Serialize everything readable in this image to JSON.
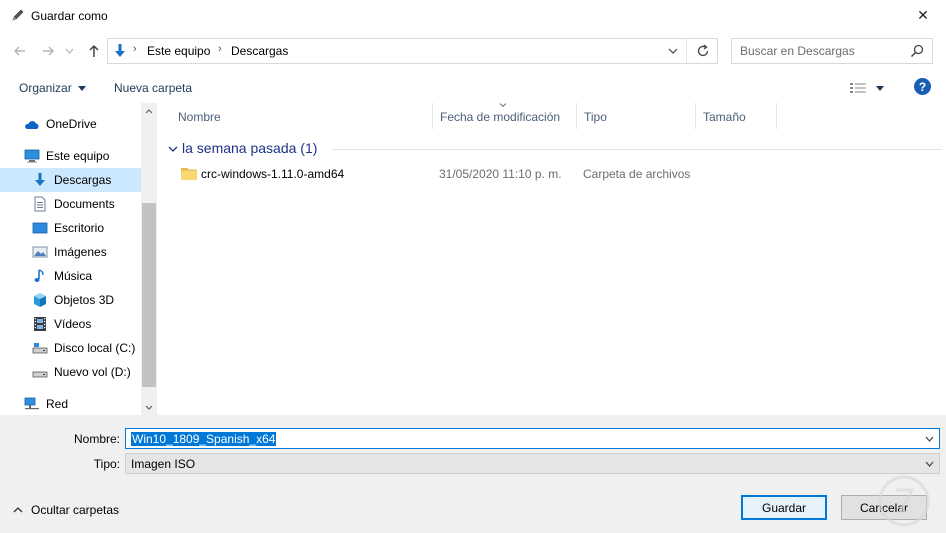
{
  "window": {
    "title": "Guardar como",
    "close_glyph": "✕"
  },
  "address": {
    "crumbs": [
      "Este equipo",
      "Descargas"
    ],
    "separator": "›"
  },
  "search": {
    "placeholder": "Buscar en Descargas"
  },
  "toolbar": {
    "organize": "Organizar",
    "new_folder": "Nueva carpeta"
  },
  "sidebar": {
    "items": [
      {
        "label": "OneDrive",
        "icon": "cloud-icon"
      },
      {
        "label": "Este equipo",
        "icon": "computer-icon"
      },
      {
        "label": "Descargas",
        "icon": "download-arrow-icon",
        "selected": true
      },
      {
        "label": "Documents",
        "icon": "document-icon"
      },
      {
        "label": "Escritorio",
        "icon": "desktop-icon"
      },
      {
        "label": "Imágenes",
        "icon": "pictures-icon"
      },
      {
        "label": "Música",
        "icon": "music-note-icon"
      },
      {
        "label": "Objetos 3D",
        "icon": "cube-3d-icon"
      },
      {
        "label": "Vídeos",
        "icon": "film-icon"
      },
      {
        "label": "Disco local (C:)",
        "icon": "hard-drive-icon"
      },
      {
        "label": "Nuevo vol (D:)",
        "icon": "drive-icon"
      },
      {
        "label": "Red",
        "icon": "network-icon"
      }
    ]
  },
  "columns": [
    "Nombre",
    "Fecha de modificación",
    "Tipo",
    "Tamaño"
  ],
  "group": {
    "title": "la semana pasada (1)"
  },
  "files": [
    {
      "name": "crc-windows-1.11.0-amd64",
      "date": "31/05/2020 11:10 p. m.",
      "type": "Carpeta de archivos",
      "size": ""
    }
  ],
  "form": {
    "name_label": "Nombre:",
    "name_value": "Win10_1809_Spanish_x64",
    "type_label": "Tipo:",
    "type_value": "Imagen ISO"
  },
  "footer": {
    "hide_folders": "Ocultar carpetas",
    "save": "Guardar",
    "cancel": "Cancelar"
  },
  "colors": {
    "accent": "#0078d7",
    "selected_bg": "#cce8ff",
    "group_title": "#1e3287",
    "link_text": "#1e3957",
    "folder_yellow": "#f8d775"
  }
}
